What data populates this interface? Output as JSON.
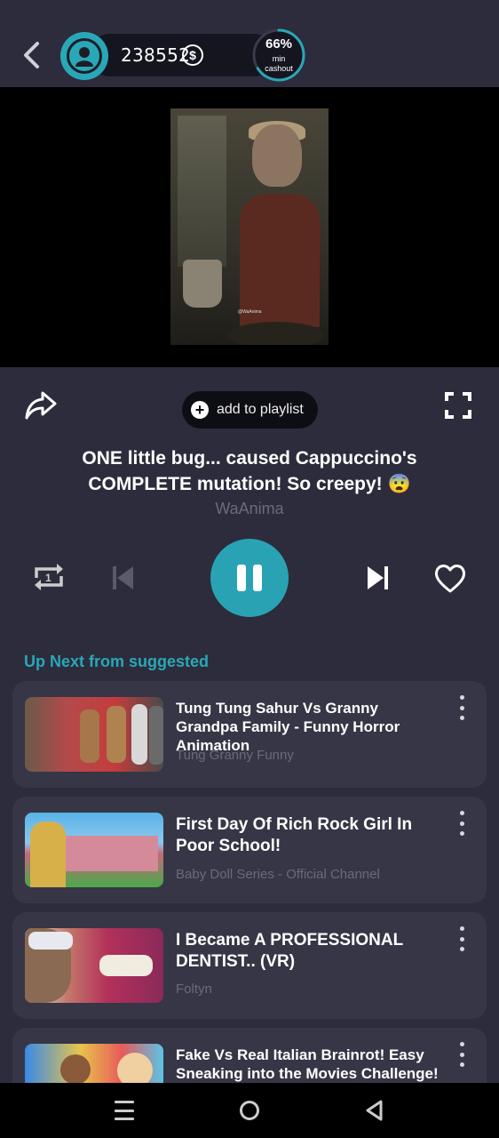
{
  "header": {
    "balance": "238552",
    "currency_symbol": "$",
    "cashout_percent": "66%",
    "cashout_label_line1": "min",
    "cashout_label_line2": "cashout",
    "cashout_progress": 0.66,
    "accent_color": "#2aa7b6"
  },
  "video": {
    "watermark": "@WaAnima"
  },
  "actions": {
    "add_to_playlist": "add to playlist"
  },
  "now_playing": {
    "title": "ONE little bug... caused Cappuccino's COMPLETE mutation! So creepy! 😨",
    "channel": "WaAnima"
  },
  "up_next": {
    "heading": "Up Next from suggested",
    "items": [
      {
        "title": "Tung Tung Sahur Vs Granny Grandpa Family - Funny Horror Animation",
        "channel": "Tung Granny Funny"
      },
      {
        "title": "First Day Of Rich Rock Girl In Poor School!",
        "channel": "Baby Doll Series - Official Channel"
      },
      {
        "title": "I Became A PROFESSIONAL DENTIST.. (VR)",
        "channel": "Foltyn"
      },
      {
        "title": "Fake Vs Real Italian Brainrot! Easy Sneaking into the Movies Challenge!",
        "channel": ""
      }
    ]
  },
  "icons": [
    "back-chevron-icon",
    "user-icon",
    "dollar-icon",
    "share-icon",
    "plus-icon",
    "fullscreen-icon",
    "repeat-icon",
    "previous-icon",
    "pause-icon",
    "next-icon",
    "heart-icon",
    "more-vertical-icon"
  ]
}
